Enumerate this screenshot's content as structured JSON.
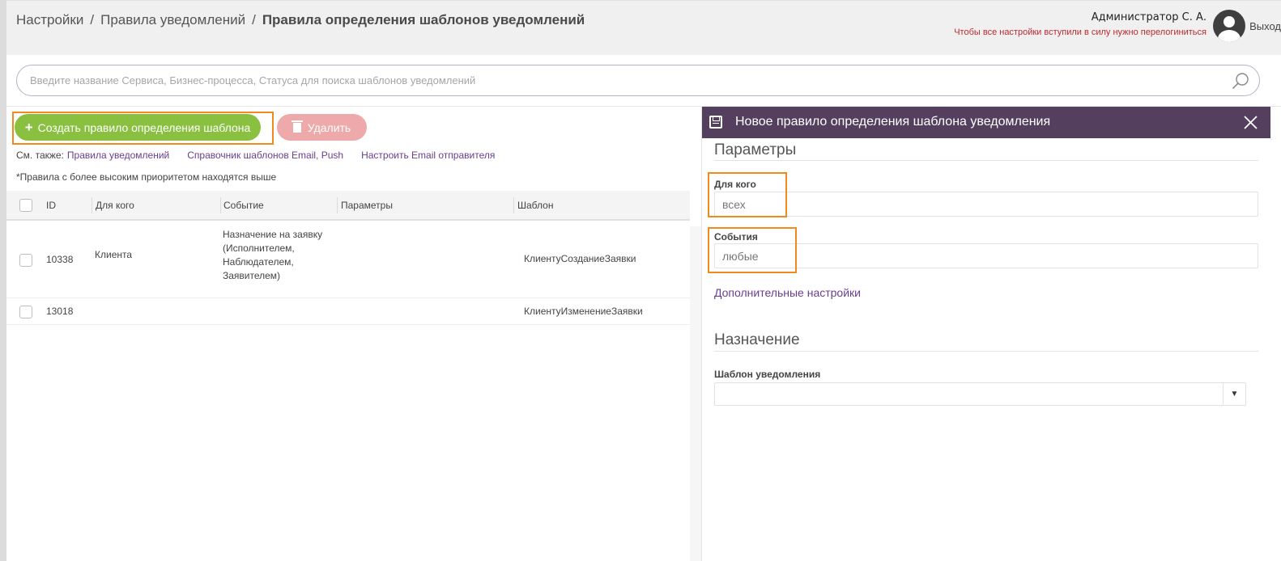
{
  "breadcrumb": {
    "items": [
      "Настройки",
      "Правила уведомлений"
    ],
    "separator": "/",
    "current": "Правила определения шаблонов уведомлений"
  },
  "user": {
    "name": "Администратор С. А.",
    "warning": "Чтобы все настройки вступили в силу нужно перелогиниться",
    "logout": "Выход",
    "avatar_icon": "user-avatar-icon"
  },
  "search": {
    "placeholder": "Введите название Сервиса, Бизнес-процесса, Статуса для поиска шаблонов уведомлений",
    "icon": "search-icon"
  },
  "toolbar": {
    "create_plus": "+",
    "create_label": "Создать правило определения шаблона",
    "delete_label": "Удалить",
    "delete_icon": "trash-icon"
  },
  "see_also": {
    "label": "См. также:",
    "links": [
      "Правила уведомлений",
      "Справочник шаблонов Email, Push",
      "Настроить Email отправителя"
    ]
  },
  "note": "*Правила с более высоким приоритетом находятся выше",
  "table": {
    "columns": [
      "ID",
      "Для кого",
      "Событие",
      "Параметры",
      "Шаблон"
    ],
    "rows": [
      {
        "id": "10338",
        "for_whom": "Клиента",
        "event_lines": [
          "Назначение на заявку",
          "(Исполнителем,",
          "Наблюдателем,",
          "Заявителем)"
        ],
        "params": "",
        "template": "КлиентуСозданиеЗаявки"
      },
      {
        "id": "13018",
        "for_whom": "",
        "event_lines": [],
        "params": "",
        "template": "КлиентуИзменениеЗаявки"
      }
    ]
  },
  "side_panel": {
    "title": "Новое правило определения шаблона уведомления",
    "save_icon": "save-icon",
    "close_icon": "close-icon",
    "params_section": "Параметры",
    "for_whom_label": "Для кого",
    "for_whom_value": "всех",
    "events_label": "События",
    "events_value": "любые",
    "advanced_link": "Дополнительные настройки",
    "assign_section": "Назначение",
    "template_label": "Шаблон уведомления",
    "template_value": "",
    "caret": "▼"
  },
  "colors": {
    "accent_purple": "#553f5e",
    "create_green": "#8ac040",
    "delete_pink": "#eeaaaa",
    "highlight_orange": "#f08a1c",
    "link_purple": "#6a3e8e",
    "warning_red": "#c0282e"
  }
}
